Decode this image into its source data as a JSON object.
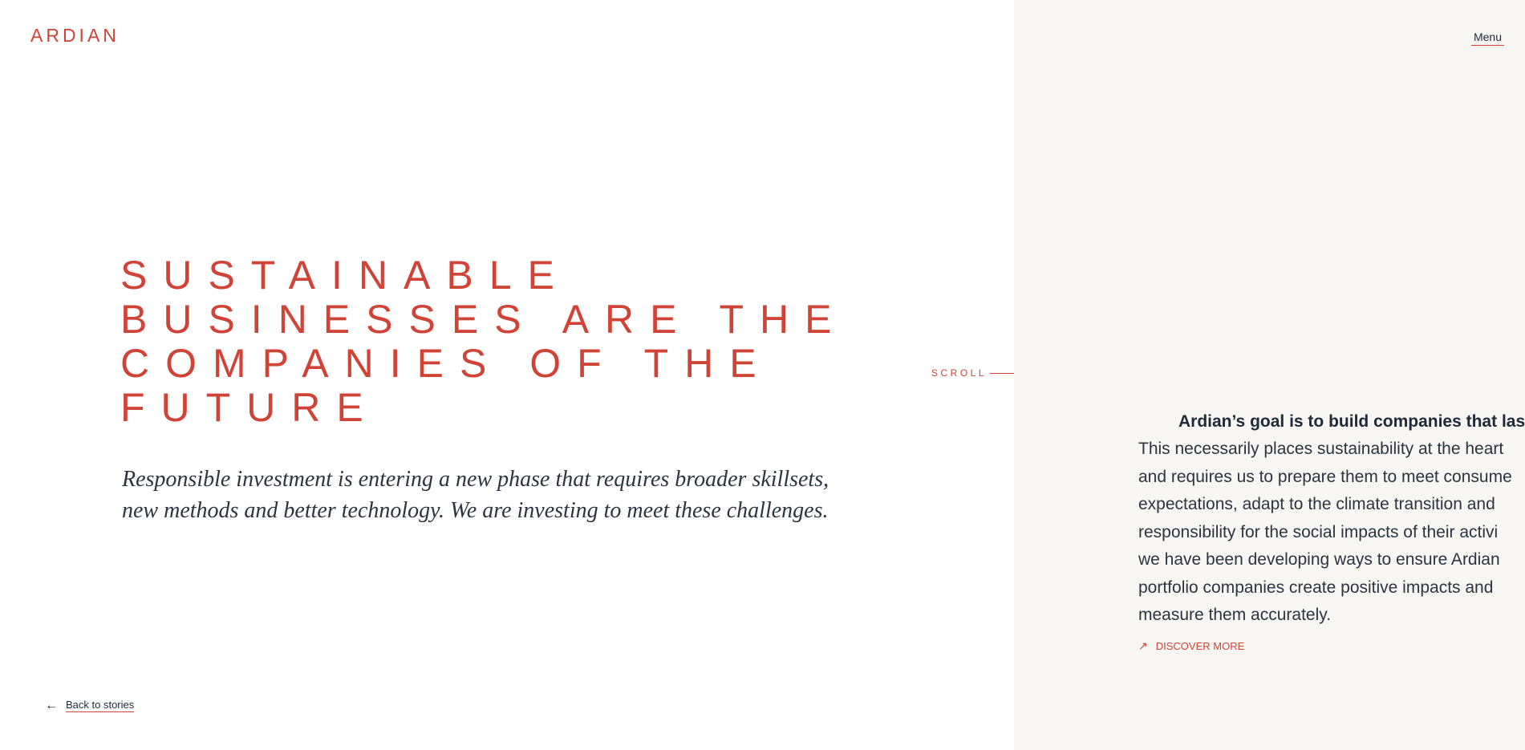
{
  "header": {
    "logo": "ARDIAN",
    "menu_label": "Menu"
  },
  "hero": {
    "title_lines": [
      "SUSTAINABLE",
      "BUSINESSES ARE THE",
      "COMPANIES OF THE",
      "FUTURE"
    ],
    "subtitle_lines": [
      "Responsible investment is entering a new phase that requires broader skillsets,",
      "new methods and better technology. We are investing to meet these challenges."
    ]
  },
  "scroll": {
    "label": "SCROLL"
  },
  "back": {
    "label": "Back to stories"
  },
  "story": {
    "lead": "Ardian’s goal is to build companies that last",
    "body_lines": [
      "This necessarily places sustainability at the heart",
      "and requires us to prepare them to meet consume",
      "expectations, adapt to the climate transition and",
      "responsibility for the social impacts of their activi",
      "we have been developing ways to ensure Ardian",
      "portfolio companies create positive impacts and",
      "measure them accurately."
    ],
    "discover_label": "DISCOVER MORE"
  },
  "icons": {
    "back": "arrow-left-icon",
    "discover": "arrow-up-right-icon"
  },
  "colors": {
    "accent": "#cf4436",
    "text": "#2b3440",
    "panel_background": "#f7f6f2"
  }
}
